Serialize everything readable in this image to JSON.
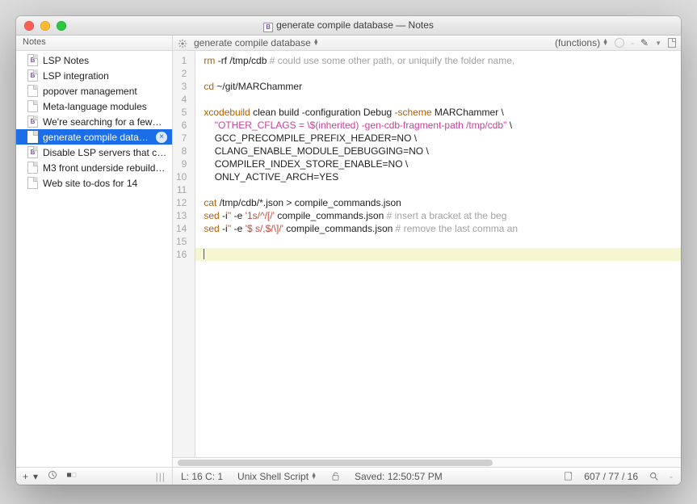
{
  "window_title": "generate compile database — Notes",
  "sidebar": {
    "header": "Notes",
    "items": [
      {
        "label": "LSP Notes",
        "icon": "purple"
      },
      {
        "label": "LSP integration",
        "icon": "purple"
      },
      {
        "label": "popover management",
        "icon": "plain"
      },
      {
        "label": "Meta-language modules",
        "icon": "plain"
      },
      {
        "label": "We're searching for a few…",
        "icon": "purple"
      },
      {
        "label": "generate compile data…",
        "icon": "plain",
        "selected": true,
        "closable": true
      },
      {
        "label": "Disable LSP servers that cr…",
        "icon": "purple"
      },
      {
        "label": "M3 front underside rebuild…",
        "icon": "plain"
      },
      {
        "label": "Web site to-dos for 14",
        "icon": "plain"
      }
    ]
  },
  "toolbar": {
    "breadcrumb": "generate compile database",
    "functions_label": "(functions)"
  },
  "code": {
    "lines": [
      [
        {
          "t": "rm",
          "c": "kw"
        },
        {
          "t": " -rf /tmp/cdb "
        },
        {
          "t": "# could use some other path, or uniquify the folder name,",
          "c": "cm"
        }
      ],
      [],
      [
        {
          "t": "cd",
          "c": "kw"
        },
        {
          "t": " ~/git/MARChammer"
        }
      ],
      [],
      [
        {
          "t": "xcodebuild",
          "c": "kw"
        },
        {
          "t": " clean build -configuration Debug "
        },
        {
          "t": "-scheme",
          "c": "kw"
        },
        {
          "t": " MARChammer \\"
        }
      ],
      [
        {
          "t": "    "
        },
        {
          "t": "\"OTHER_CFLAGS = \\$(inherited) -gen-cdb-fragment-path /tmp/cdb\"",
          "c": "str"
        },
        {
          "t": " \\"
        }
      ],
      [
        {
          "t": "    GCC_PRECOMPILE_PREFIX_HEADER=NO \\"
        }
      ],
      [
        {
          "t": "    CLANG_ENABLE_MODULE_DEBUGGING=NO \\"
        }
      ],
      [
        {
          "t": "    COMPILER_INDEX_STORE_ENABLE=NO \\"
        }
      ],
      [
        {
          "t": "    ONLY_ACTIVE_ARCH=YES"
        }
      ],
      [],
      [
        {
          "t": "cat",
          "c": "kw"
        },
        {
          "t": " /tmp/cdb/*.json > compile_commands.json"
        }
      ],
      [
        {
          "t": "sed",
          "c": "kw"
        },
        {
          "t": " -i"
        },
        {
          "t": "''",
          "c": "str2"
        },
        {
          "t": " -e "
        },
        {
          "t": "'1s/^/[/'",
          "c": "str2"
        },
        {
          "t": " compile_commands.json "
        },
        {
          "t": "# insert a bracket at the beg",
          "c": "cm"
        }
      ],
      [
        {
          "t": "sed",
          "c": "kw"
        },
        {
          "t": " -i"
        },
        {
          "t": "''",
          "c": "str2"
        },
        {
          "t": " -e "
        },
        {
          "t": "'$ s/,$/\\]/'",
          "c": "str2"
        },
        {
          "t": " compile_commands.json "
        },
        {
          "t": "# remove the last comma an",
          "c": "cm"
        }
      ],
      [],
      []
    ],
    "highlight_line": 16
  },
  "status": {
    "cursor": "L: 16 C: 1",
    "language": "Unix Shell Script",
    "saved": "Saved: 12:50:57 PM",
    "counts": "607 / 77 / 16",
    "search_label": "-"
  }
}
